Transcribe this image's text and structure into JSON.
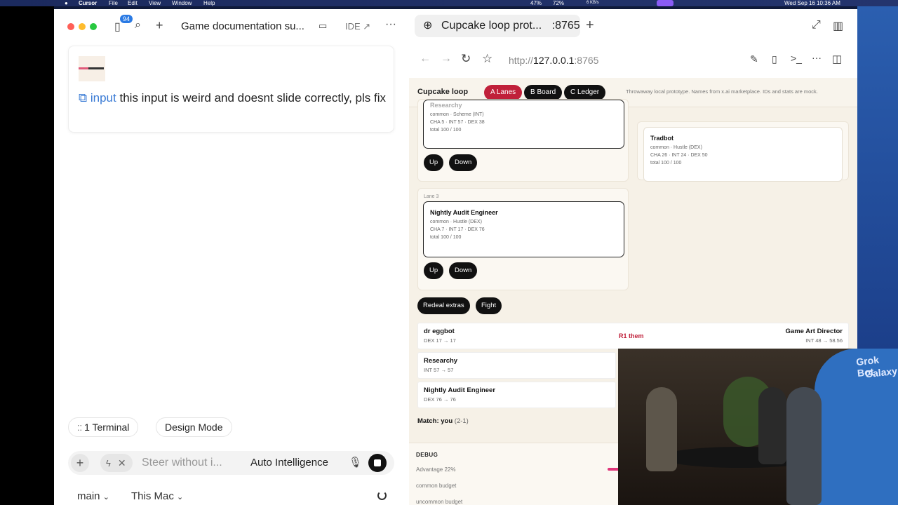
{
  "menubar": {
    "app_name": "Cursor",
    "menus": [
      "File",
      "Edit",
      "View",
      "Window",
      "Help"
    ],
    "battery1": "47%",
    "battery2": "72%",
    "net": "6 KB/s",
    "datetime": "Wed Sep 16  10:36 AM"
  },
  "cursor_window": {
    "badge_count": "94",
    "tab_title": "Game documentation su...",
    "ide_label": "IDE ↗",
    "message": {
      "tag": "input",
      "text": "this input is weird and doesnt slide correctly, pls fix"
    },
    "terminal_label": "1 Terminal",
    "design_mode_label": "Design Mode",
    "input_placeholder": "Steer without i...",
    "model_label": "Auto Intelligence",
    "branch_label": "main",
    "location_label": "This Mac"
  },
  "browser": {
    "tab_title": "Cupcake loop prot...",
    "tab_port": ":8765",
    "url_prefix": "http://",
    "url_host": "127.0.0.1",
    "url_port": ":8765"
  },
  "page": {
    "brand": "Cupcake loop",
    "chips": {
      "lanes": "A Lanes",
      "board": "B Board",
      "ledger": "C Ledger"
    },
    "note": "Throwaway local prototype. Names from x.ai marketplace. IDs and stats are mock.",
    "colors": {
      "accent": "#c0203a",
      "chip": "#111111",
      "page_bg": "#f6f1e7"
    },
    "lane_top": {
      "name": "Researchy",
      "rarity": "common · Scheme (INT)",
      "stats": "CHA 5 · INT 57 · DEX 38",
      "total": "total 100 / 100"
    },
    "up_label": "Up",
    "down_label": "Down",
    "lane3": {
      "label": "Lane 3",
      "name": "Nightly Audit Engineer",
      "rarity": "common · Hustle (DEX)",
      "stats": "CHA 7 · INT 17 · DEX 76",
      "total": "total 100 / 100"
    },
    "bench": {
      "name": "Tradbot",
      "rarity": "common · Hustle (DEX)",
      "stats": "CHA 26 · INT 24 · DEX 50",
      "total": "total 100 / 100"
    },
    "redeal_label": "Redeal extras",
    "fight_label": "Fight",
    "fights": [
      {
        "name": "dr eggbot",
        "stat": "DEX 17 → 17"
      },
      {
        "name": "Researchy",
        "stat": "INT 57 → 57"
      },
      {
        "name": "Nightly Audit Engineer",
        "stat": "DEX 76 → 76"
      }
    ],
    "opponent": {
      "name": "Game Art Director",
      "stat": "INT 48 → 58.56"
    },
    "result_tag": "R1 them",
    "match_label": "Match: you",
    "match_score": "(2-1)",
    "debug": {
      "title": "DEBUG",
      "advantage": "Advantage 22%",
      "common_budget": "common budget",
      "uncommon_budget": "uncommon budget"
    }
  },
  "video": {
    "overlay_line1": "Grok Bot",
    "overlay_line2": "Galaxy"
  }
}
